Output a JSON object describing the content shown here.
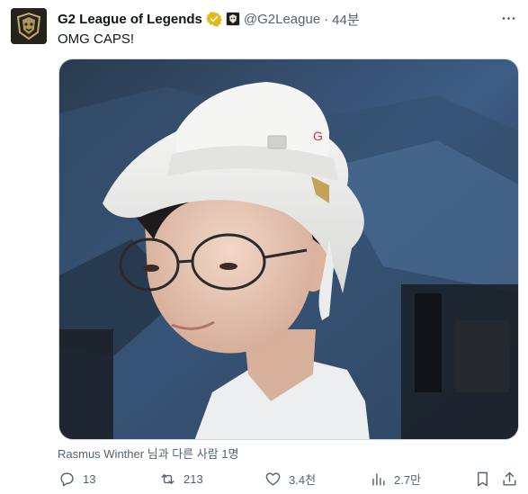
{
  "tweet": {
    "author_name": "G2 League of Legends",
    "handle": "@G2League",
    "separator": "·",
    "time": "44분",
    "text": "OMG CAPS!",
    "tagged_line": "Rasmus Winther 님과 다른 사람 1명"
  },
  "media": {
    "description_icon": "photo"
  },
  "actions": {
    "replies": "13",
    "retweets": "213",
    "likes": "3.4천",
    "views": "2.7만"
  },
  "icons": {
    "verified": "verified-badge-icon",
    "affiliate": "g2-affiliate-icon",
    "more": "more-dots-icon",
    "reply": "reply-icon",
    "retweet": "retweet-icon",
    "like": "heart-icon",
    "views": "views-chart-icon",
    "bookmark": "bookmark-icon",
    "share": "share-icon"
  },
  "colors": {
    "verified_gold": "#e2b719",
    "text_primary": "#0f1419",
    "text_secondary": "#536471"
  }
}
